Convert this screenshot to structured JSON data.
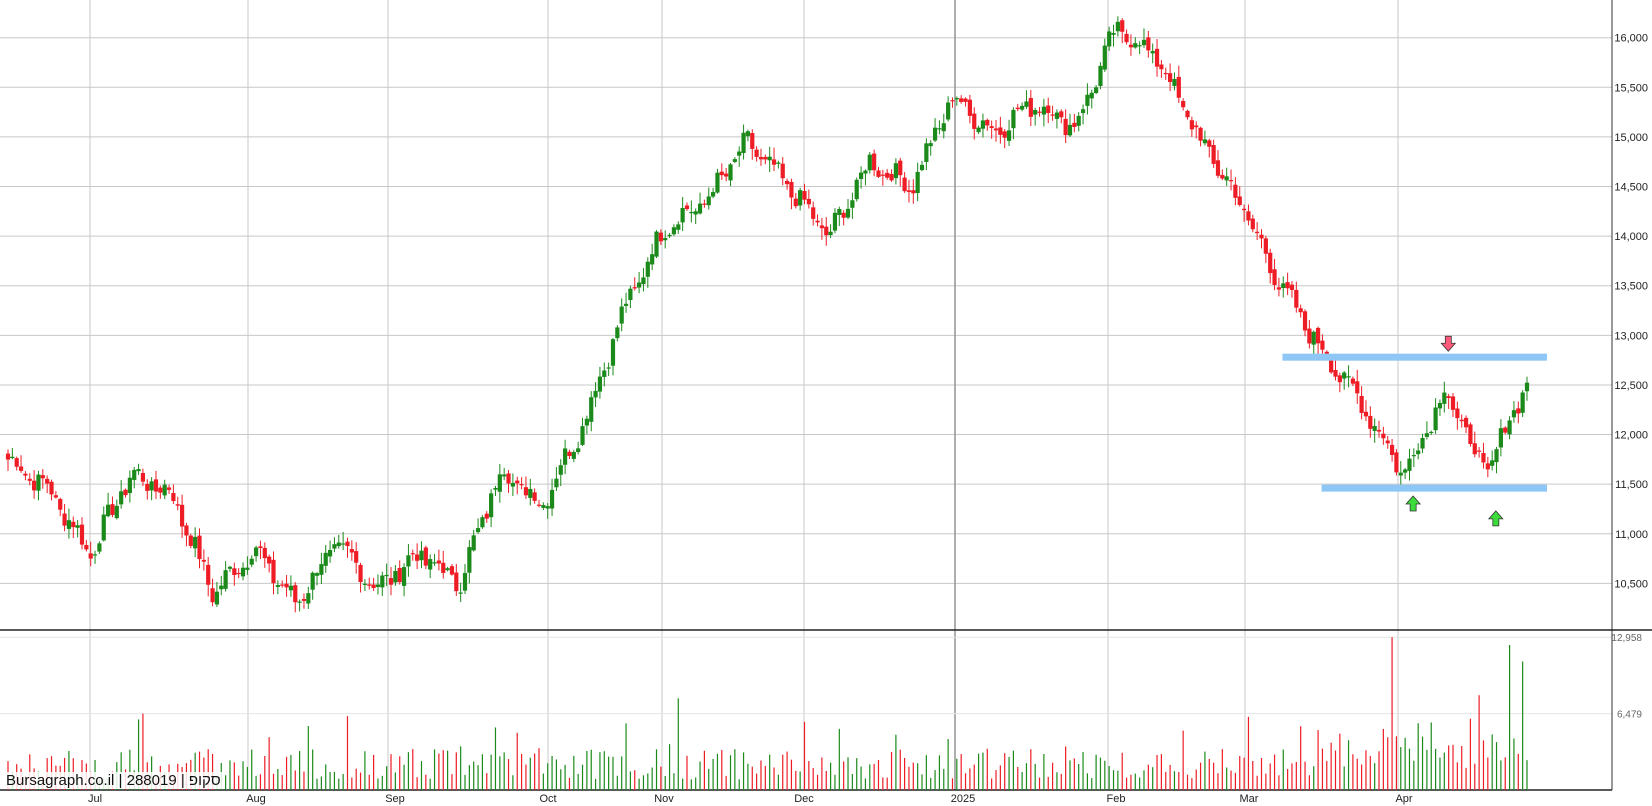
{
  "watermark": "Bursagraph.co.il | 288019 | סקופ",
  "colors": {
    "up": "#1b8a1b",
    "down": "#ee1c25",
    "grid": "#c8c8c8",
    "zone": "#8ec6f5",
    "arrow_up": "#3ddc3d",
    "arrow_down": "#ff5a7a"
  },
  "chart_data": [
    {
      "type": "candlestick",
      "title": "",
      "x_labels": [
        "Jul",
        "Aug",
        "Sep",
        "Oct",
        "Nov",
        "Dec",
        "2025",
        "Feb",
        "Mar",
        "Apr"
      ],
      "y_ticks": [
        10500,
        11000,
        11500,
        12000,
        12500,
        13000,
        13500,
        14000,
        14500,
        15000,
        15500,
        16000
      ],
      "y_tick_labels": [
        "10,500",
        "11,000",
        "11,500",
        "12,000",
        "12,500",
        "13,000",
        "13,500",
        "14,000",
        "14,500",
        "15,000",
        "15,500",
        "16,000"
      ],
      "ylim": [
        10030,
        16380
      ],
      "y_axis_side": "right",
      "grid": true,
      "anchors": [
        {
          "date": "Jun 2024 (start)",
          "close": 11750
        },
        {
          "date": "Jun end",
          "close": 11450
        },
        {
          "date": "Jul early",
          "close": 10800
        },
        {
          "date": "Jul mid",
          "close": 11600
        },
        {
          "date": "Jul end",
          "close": 11400
        },
        {
          "date": "Aug mid",
          "close": 10400
        },
        {
          "date": "Aug end",
          "close": 10850
        },
        {
          "date": "Sep early",
          "close": 10300
        },
        {
          "date": "Sep mid",
          "close": 10900
        },
        {
          "date": "Sep end",
          "close": 10450
        },
        {
          "date": "Oct early",
          "close": 10800
        },
        {
          "date": "Oct mid",
          "close": 10500
        },
        {
          "date": "Oct end",
          "close": 11650
        },
        {
          "date": "Nov early",
          "close": 11300
        },
        {
          "date": "Nov mid",
          "close": 12100
        },
        {
          "date": "Nov 3rd wk",
          "close": 13250
        },
        {
          "date": "Nov end",
          "close": 14100
        },
        {
          "date": "Dec early",
          "close": 14350
        },
        {
          "date": "Dec mid",
          "close": 14950
        },
        {
          "date": "Dec 3rd wk",
          "close": 14500
        },
        {
          "date": "Dec end",
          "close": 14000
        },
        {
          "date": "Jan early",
          "close": 14750
        },
        {
          "date": "Jan mid",
          "close": 14500
        },
        {
          "date": "Jan 3rd wk",
          "close": 15400
        },
        {
          "date": "Jan end",
          "close": 15050
        },
        {
          "date": "Feb early",
          "close": 15350
        },
        {
          "date": "Feb mid",
          "close": 15100
        },
        {
          "date": "Feb 3rd wk",
          "close": 16100
        },
        {
          "date": "Feb end",
          "close": 15800
        },
        {
          "date": "Mar early",
          "close": 15000
        },
        {
          "date": "Mar mid",
          "close": 14350
        },
        {
          "date": "Mar 3rd wk",
          "close": 13500
        },
        {
          "date": "Mar end",
          "close": 12850
        },
        {
          "date": "Apr 1st wk",
          "close": 12300
        },
        {
          "date": "Apr early",
          "close": 11600
        },
        {
          "date": "Apr mid",
          "close": 12450
        },
        {
          "date": "Apr 3rd wk",
          "close": 11600
        },
        {
          "date": "Apr end",
          "close": 12550
        }
      ],
      "zones": [
        {
          "name": "resistance",
          "value": 12780,
          "from": "Mar end",
          "to": "Apr end"
        },
        {
          "name": "support",
          "value": 11460,
          "from": "Apr 1st wk",
          "to": "Apr end"
        }
      ],
      "markers": [
        {
          "type": "up",
          "near": "Apr early",
          "value": 11300
        },
        {
          "type": "up",
          "near": "Apr 3rd wk",
          "value": 11150
        },
        {
          "type": "down",
          "near": "Apr mid",
          "value": 12920
        }
      ]
    },
    {
      "type": "bar",
      "title": "",
      "y_ticks": [
        6479,
        12958
      ],
      "y_tick_labels": [
        "6,479",
        "12,958"
      ],
      "ylim": [
        0,
        12958
      ]
    }
  ]
}
